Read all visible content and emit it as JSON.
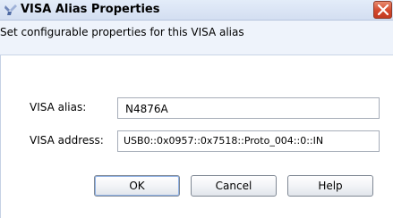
{
  "window": {
    "title": "VISA Alias Properties",
    "title_icon": "visa-app-icon",
    "close_icon": "close-icon"
  },
  "header": {
    "description": "Set configurable properties for this VISA alias"
  },
  "form": {
    "alias_label": "VISA alias:",
    "alias_value": "N4876A",
    "address_label": "VISA address:",
    "address_value": "USB0::0x0957::0x7518::Proto_004::0::IN"
  },
  "buttons": {
    "ok": "OK",
    "cancel": "Cancel",
    "help": "Help"
  },
  "colors": {
    "title_bar": "#d3def1",
    "description_bar": "#eef3fb",
    "close_button": "#d3472c"
  }
}
